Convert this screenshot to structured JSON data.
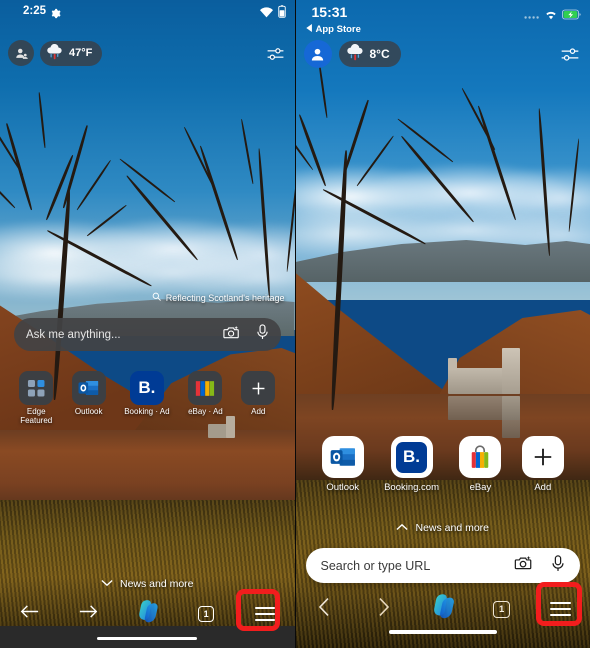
{
  "meta": {
    "title": "Microsoft Edge mobile new tab page comparison",
    "accent_blue": "#0f6cbd",
    "highlight_red": "#f21d1d"
  },
  "panels": [
    {
      "id": "android",
      "platform": "Android",
      "status": {
        "time": "2:25",
        "gear_icon": "gear-icon",
        "wifi_icon": "wifi-icon",
        "battery_icon": "battery-icon"
      },
      "chips": {
        "avatar_icon": "account-avatar-icon",
        "weather_icon": "rain-cloud-icon",
        "weather_temp": "47°F",
        "tuner_icon": "page-settings-sliders-icon"
      },
      "caption": {
        "search_icon": "search-icon",
        "text": "Reflecting Scotland's heritage"
      },
      "search": {
        "placeholder": "Ask me anything...",
        "camera_icon": "camera-sparkle-icon",
        "mic_icon": "microphone-icon"
      },
      "tiles": [
        {
          "label": "Edge\nFeatured",
          "icon": "edge-featured-grid-icon"
        },
        {
          "label": "Outlook",
          "icon": "outlook-icon"
        },
        {
          "label": "Booking · Ad",
          "icon": "booking-icon"
        },
        {
          "label": "eBay · Ad",
          "icon": "ebay-icon"
        },
        {
          "label": "Add",
          "icon": "plus-icon"
        }
      ],
      "news": {
        "label": "News and more",
        "chevron": "chevron-down-icon"
      },
      "toolbar": {
        "back_icon": "back-arrow-icon",
        "forward_icon": "forward-arrow-icon",
        "copilot_icon": "copilot-icon",
        "tab_count": "1",
        "menu_icon": "hamburger-menu-icon"
      }
    },
    {
      "id": "ios",
      "platform": "iOS",
      "status": {
        "time": "15:31",
        "back_label": "App Store",
        "back_icon": "back-triangle-icon",
        "signal_icon": "signal-dots-icon",
        "wifi_icon": "wifi-icon",
        "battery_icon": "battery-charging-icon"
      },
      "chips": {
        "avatar_icon": "account-avatar-icon",
        "weather_icon": "rain-cloud-icon",
        "weather_temp": "8°C",
        "tuner_icon": "page-settings-sliders-icon"
      },
      "search": {
        "placeholder": "Search or type URL",
        "camera_icon": "camera-sparkle-icon",
        "mic_icon": "microphone-icon"
      },
      "tiles": [
        {
          "label": "Outlook",
          "icon": "outlook-icon"
        },
        {
          "label": "Booking.com",
          "icon": "booking-icon"
        },
        {
          "label": "eBay",
          "icon": "ebay-bag-icon"
        },
        {
          "label": "Add",
          "icon": "plus-icon"
        }
      ],
      "news": {
        "label": "News and more",
        "chevron": "chevron-up-icon"
      },
      "toolbar": {
        "back_icon": "back-chevron-icon",
        "forward_icon": "forward-chevron-icon",
        "copilot_icon": "copilot-icon",
        "tab_count": "1",
        "menu_icon": "hamburger-menu-icon"
      }
    }
  ]
}
